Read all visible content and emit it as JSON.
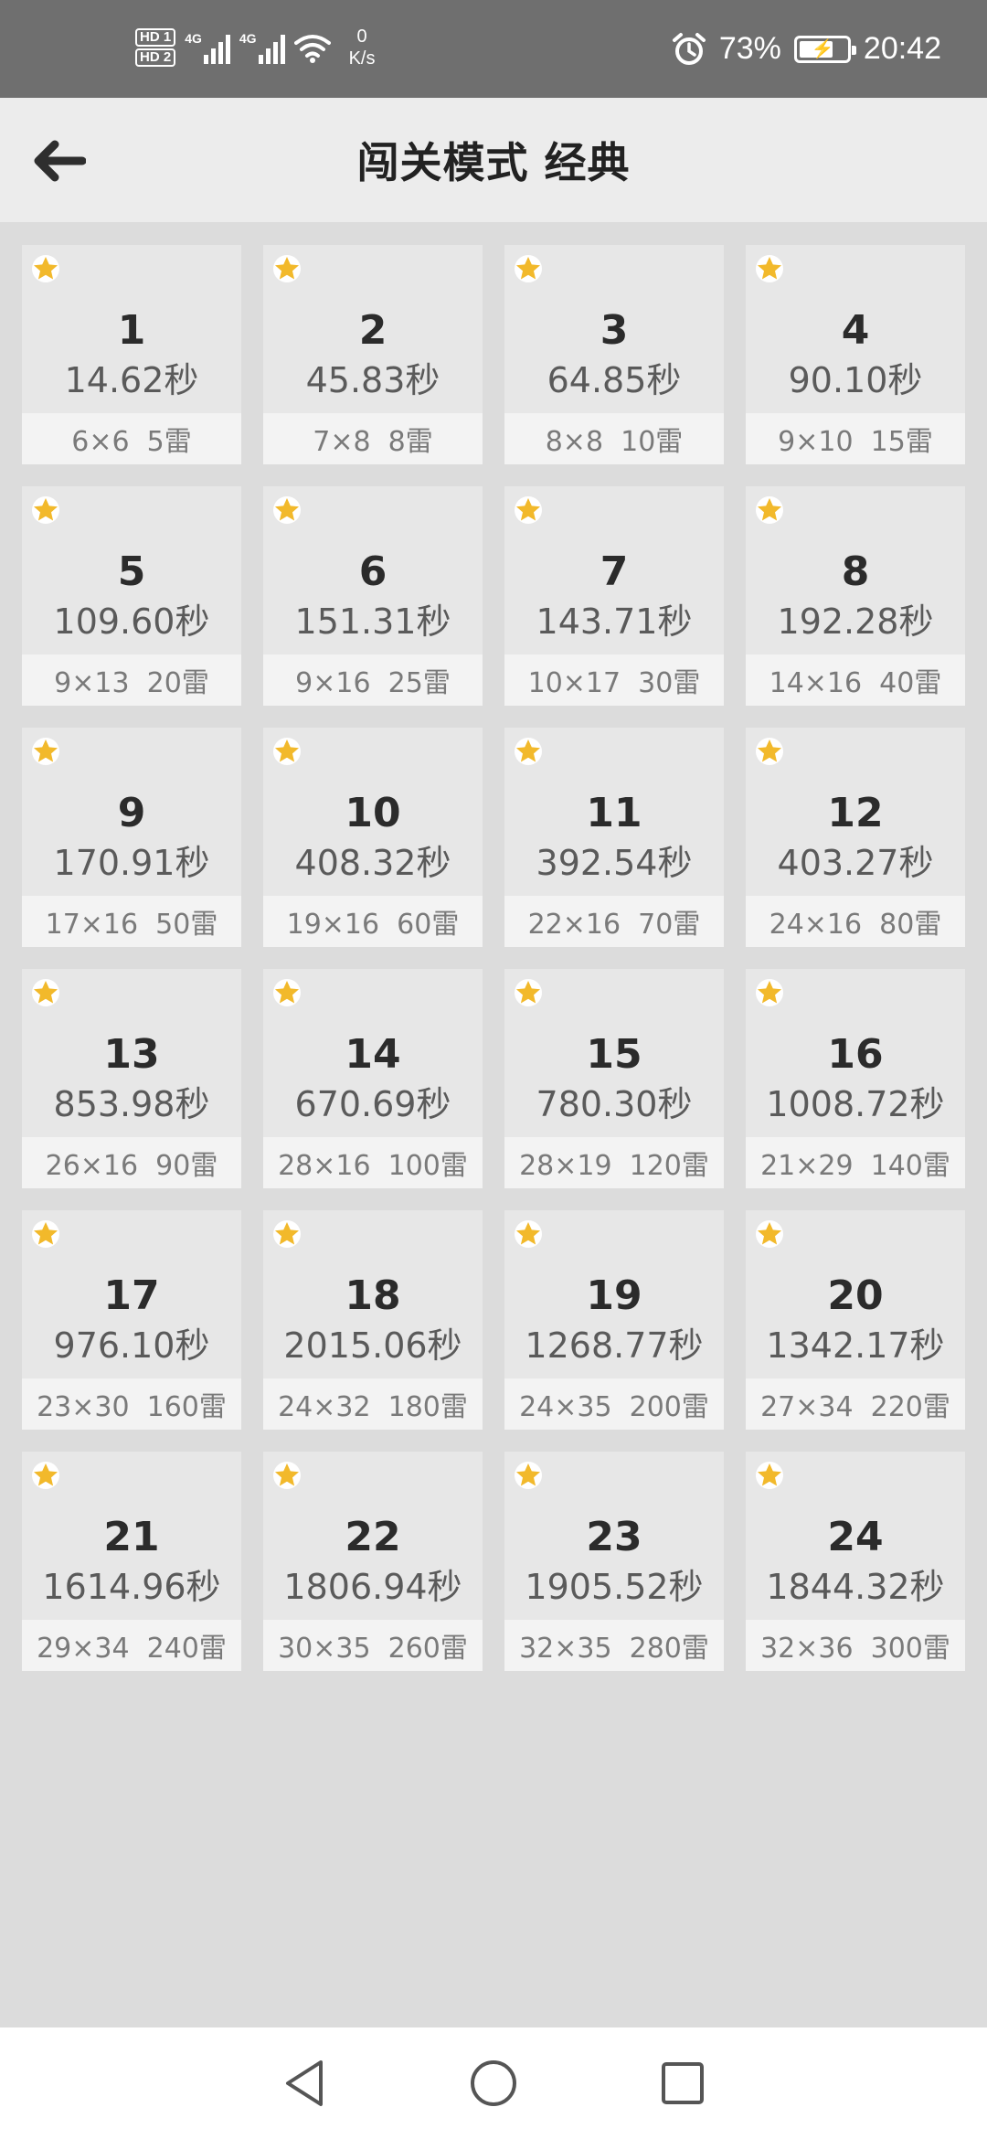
{
  "status_bar": {
    "hd1": "HD 1",
    "hd2": "HD 2",
    "net1": "4G",
    "net2": "4G",
    "speed_value": "0",
    "speed_unit": "K/s",
    "battery_percent": "73%",
    "battery_level": 73,
    "time": "20:42"
  },
  "header": {
    "title": "闯关模式 经典"
  },
  "levels": [
    {
      "num": "1",
      "time": "14.62秒",
      "info": "6×6  5雷"
    },
    {
      "num": "2",
      "time": "45.83秒",
      "info": "7×8  8雷"
    },
    {
      "num": "3",
      "time": "64.85秒",
      "info": "8×8  10雷"
    },
    {
      "num": "4",
      "time": "90.10秒",
      "info": "9×10  15雷"
    },
    {
      "num": "5",
      "time": "109.60秒",
      "info": "9×13  20雷"
    },
    {
      "num": "6",
      "time": "151.31秒",
      "info": "9×16  25雷"
    },
    {
      "num": "7",
      "time": "143.71秒",
      "info": "10×17  30雷"
    },
    {
      "num": "8",
      "time": "192.28秒",
      "info": "14×16  40雷"
    },
    {
      "num": "9",
      "time": "170.91秒",
      "info": "17×16  50雷"
    },
    {
      "num": "10",
      "time": "408.32秒",
      "info": "19×16  60雷"
    },
    {
      "num": "11",
      "time": "392.54秒",
      "info": "22×16  70雷"
    },
    {
      "num": "12",
      "time": "403.27秒",
      "info": "24×16  80雷"
    },
    {
      "num": "13",
      "time": "853.98秒",
      "info": "26×16  90雷"
    },
    {
      "num": "14",
      "time": "670.69秒",
      "info": "28×16  100雷"
    },
    {
      "num": "15",
      "time": "780.30秒",
      "info": "28×19  120雷"
    },
    {
      "num": "16",
      "time": "1008.72秒",
      "info": "21×29  140雷"
    },
    {
      "num": "17",
      "time": "976.10秒",
      "info": "23×30  160雷"
    },
    {
      "num": "18",
      "time": "2015.06秒",
      "info": "24×32  180雷"
    },
    {
      "num": "19",
      "time": "1268.77秒",
      "info": "24×35  200雷"
    },
    {
      "num": "20",
      "time": "1342.17秒",
      "info": "27×34  220雷"
    },
    {
      "num": "21",
      "time": "1614.96秒",
      "info": "29×34  240雷"
    },
    {
      "num": "22",
      "time": "1806.94秒",
      "info": "30×35  260雷"
    },
    {
      "num": "23",
      "time": "1905.52秒",
      "info": "32×35  280雷"
    },
    {
      "num": "24",
      "time": "1844.32秒",
      "info": "32×36  300雷"
    }
  ],
  "icons": {
    "star": "star-icon",
    "back": "back-arrow-icon",
    "nav_back": "triangle-back-icon",
    "nav_home": "circle-home-icon",
    "nav_recent": "square-recent-icon"
  },
  "colors": {
    "star": "#f2b92b",
    "header_bg": "#ececec",
    "page_bg": "#dcdcdc",
    "card_bg": "#e7e7e7",
    "card_footer_bg": "#f3f3f3",
    "status_bar_bg": "#6f6f6f"
  }
}
